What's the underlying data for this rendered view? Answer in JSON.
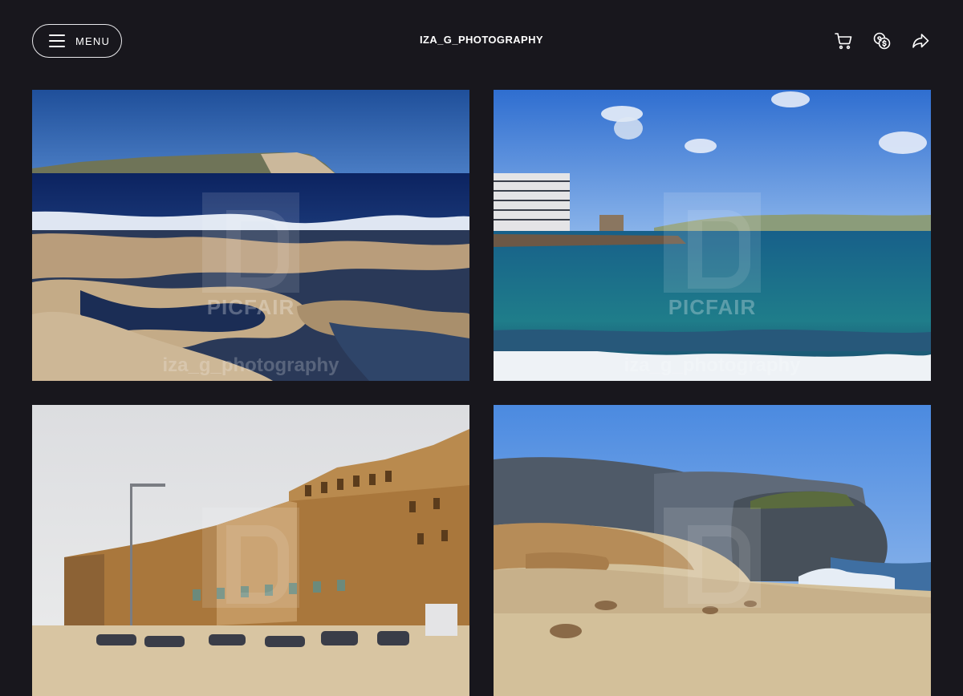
{
  "header": {
    "menu_label": "MENU",
    "brand": "IZA_G_PHOTOGRAPHY",
    "icons": [
      "menu-icon",
      "cart-icon",
      "currency-icon",
      "share-icon"
    ]
  },
  "watermark": {
    "brand": "PICFAIR",
    "credit": "iza_g_photography"
  },
  "photos": [
    {
      "subject": "rocky coastline with waves and island"
    },
    {
      "subject": "sea with hotel building and tower"
    },
    {
      "subject": "historic limestone bastion buildings"
    },
    {
      "subject": "cliffs and sea rock on sandy shore"
    }
  ],
  "colors": {
    "background": "#18171d",
    "text": "#ffffff",
    "border": "#e9e9ec"
  }
}
